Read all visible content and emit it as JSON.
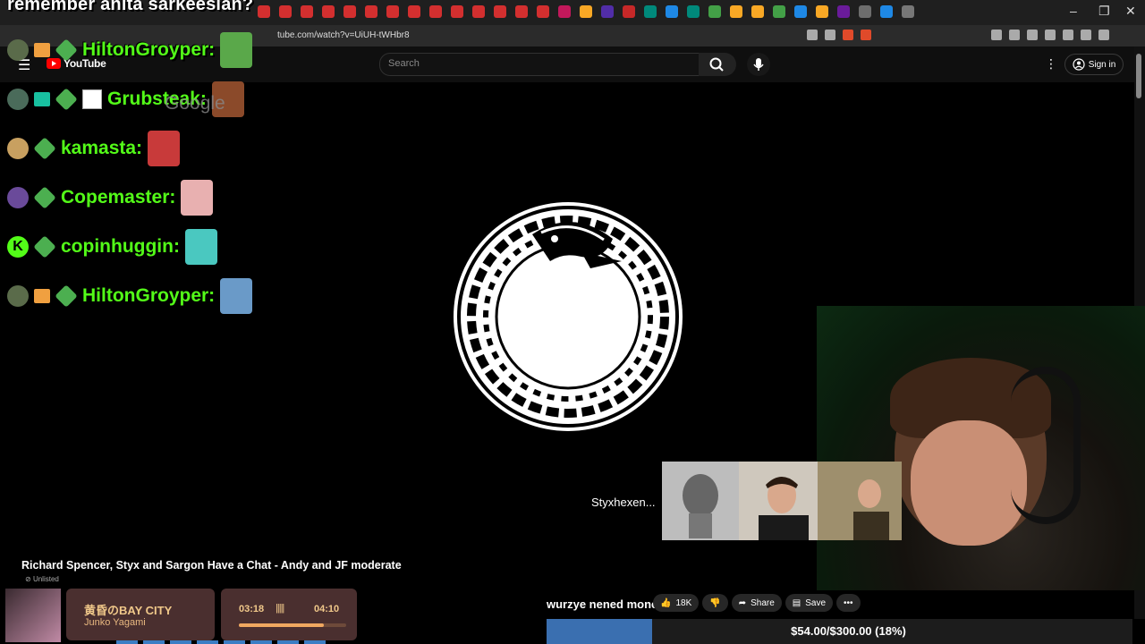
{
  "overlay_title": "remember anita sarkeesian?",
  "browser": {
    "url": "tube.com/watch?v=UiUH-tWHbr8",
    "tab_icon_colors": [
      "#d32f2f",
      "#d32f2f",
      "#d32f2f",
      "#d32f2f",
      "#d32f2f",
      "#d32f2f",
      "#d32f2f",
      "#d32f2f",
      "#d32f2f",
      "#d32f2f",
      "#d32f2f",
      "#d32f2f",
      "#d32f2f",
      "#d32f2f",
      "#c2185b",
      "#f9a825",
      "#512da8",
      "#c62828",
      "#00897b",
      "#1e88e5",
      "#00897b",
      "#43a047",
      "#f9a825",
      "#f9a825",
      "#43a047",
      "#1e88e5",
      "#f9a825",
      "#6a1b9a",
      "#6d6d6d",
      "#1e88e5",
      "#777"
    ],
    "window_controls": {
      "minimize": "–",
      "maximize": "❐",
      "close": "✕"
    }
  },
  "youtube": {
    "logo_text": "YouTube",
    "search_placeholder": "Search",
    "signin_label": "Sign in",
    "video_title": "Richard Spencer, Styx and Sargon Have a Chat - Andy and JF moderate",
    "visibility": "Unlisted",
    "thumbnail_label": "Styxhexen...",
    "like_count": "18K",
    "share_label": "Share",
    "save_label": "Save"
  },
  "chat": [
    {
      "name": "HiltonGroyper:",
      "avatar_color": "#5a6b4a",
      "badges": [
        "gift",
        "diamond"
      ],
      "emote_color": "#5aa84a"
    },
    {
      "name": "Grubsteak:",
      "avatar_color": "#4a6b5a",
      "badges": [
        "sub",
        "diamond",
        "broken"
      ],
      "emote_color": "#8b4a2a"
    },
    {
      "name": "kamasta:",
      "avatar_color": "#c8a060",
      "badges": [
        "diamond"
      ],
      "emote_color": "#c83a3a"
    },
    {
      "name": "Copemaster:",
      "avatar_color": "#6a4a9a",
      "badges": [
        "diamond"
      ],
      "emote_color": "#e8b0b0"
    },
    {
      "name": "copinhuggin:",
      "avatar_color": "#53fc18",
      "badges": [
        "k",
        "diamond"
      ],
      "emote_color": "#4ac8c0"
    },
    {
      "name": "HiltonGroyper:",
      "avatar_color": "#5a6b4a",
      "badges": [
        "gift",
        "diamond"
      ],
      "emote_color": "#6a9ac8"
    }
  ],
  "google_watermark": "Google",
  "music": {
    "title": "黄昏のBAY CITY",
    "artist": "Junko Yagami",
    "current": "03:18",
    "total": "04:10",
    "progress": 0.79,
    "bars": "|||||"
  },
  "tts_text": "wurzye nened money",
  "goal": {
    "text": "$54.00/$300.00 (18%)",
    "fraction": 0.18
  }
}
